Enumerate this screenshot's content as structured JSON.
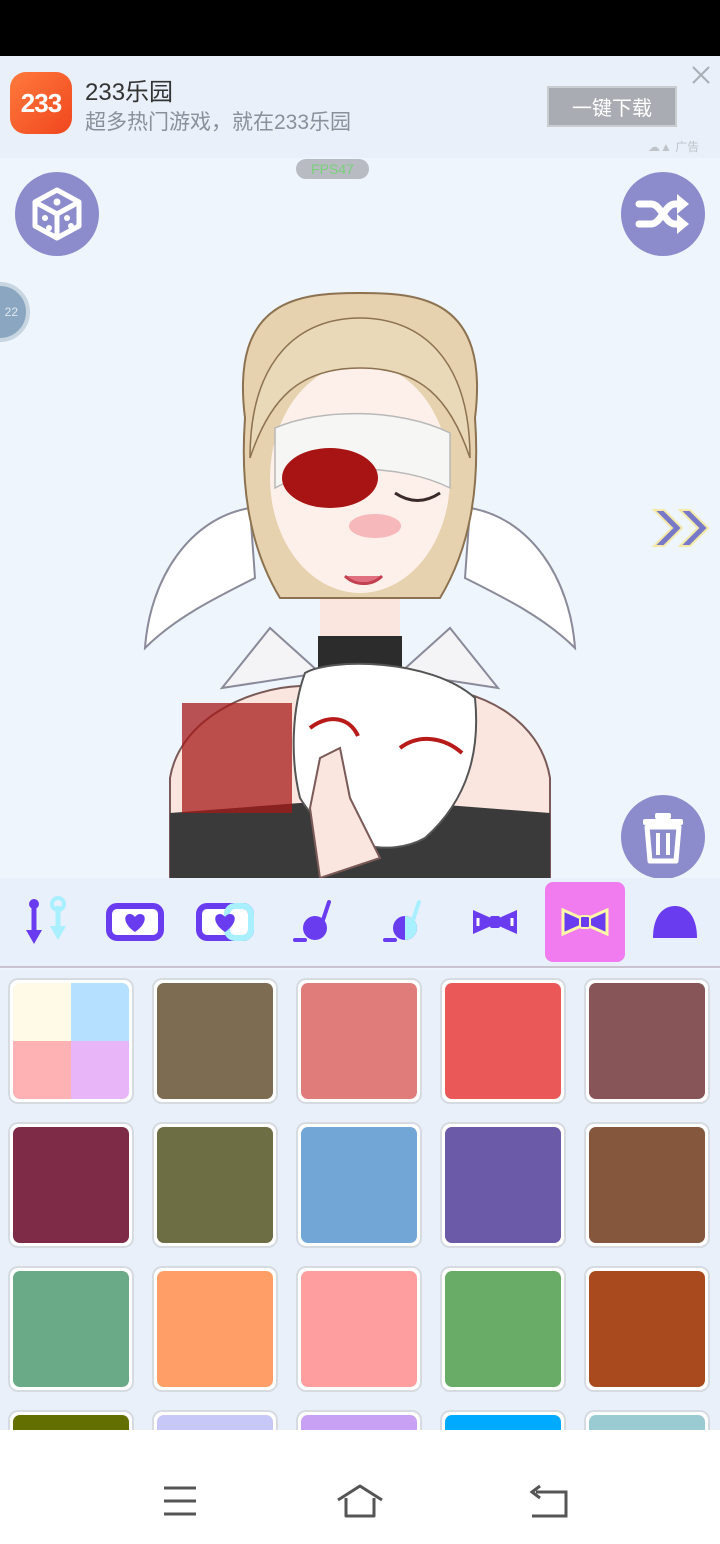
{
  "ad": {
    "logo_text": "233",
    "title": "233乐园",
    "subtitle": "超多热门游戏，就在233乐园",
    "button_label": "一键下载",
    "tag": "广告"
  },
  "stage": {
    "fps": "FPS47",
    "side_badge": "22"
  },
  "toolbar": {
    "tools": [
      {
        "icon": "eyebrow-slider-icon"
      },
      {
        "icon": "heart-frame-icon"
      },
      {
        "icon": "heart-frame-color-icon"
      },
      {
        "icon": "bomb-icon"
      },
      {
        "icon": "bomb-color-icon"
      },
      {
        "icon": "bow-icon"
      },
      {
        "icon": "bow-color-icon",
        "active": true
      },
      {
        "icon": "blob-icon"
      }
    ]
  },
  "palette": {
    "swatches": [
      "multi",
      "#7e6c52",
      "#e07c7a",
      "#ea5858",
      "#875558",
      "#7e2b48",
      "#6e6e44",
      "#72a6d6",
      "#6a5aa8",
      "#85573c",
      "#6aaa86",
      "#ff9e66",
      "#ff9e9e",
      "#68ac68",
      "#a84a1e",
      "#637000",
      "#c8c8f8",
      "#c8a0f4",
      "#00aaff",
      "#9acbd2"
    ],
    "multi_colors": [
      "#fffae8",
      "#b6e0ff",
      "#ffb2b4",
      "#e8b6f8"
    ]
  },
  "colors": {
    "accent": "#8c8ccc",
    "active_tool": "#f07cf0",
    "icon_purple": "#6a3cf0"
  }
}
